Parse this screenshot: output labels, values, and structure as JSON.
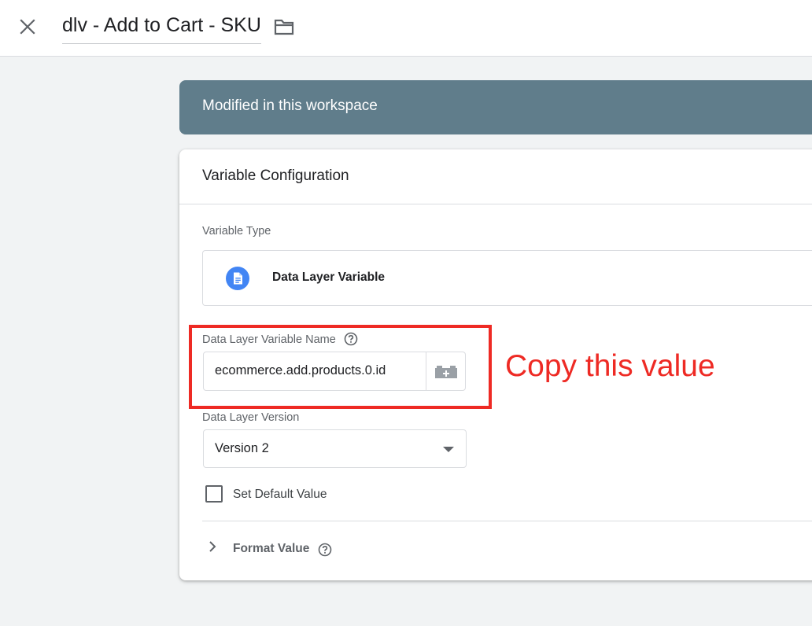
{
  "header": {
    "close_icon": "close-icon",
    "title": "dlv - Add to Cart - SKU",
    "folder_icon": "folder-icon"
  },
  "banner": {
    "text": "Modified in this workspace",
    "color": "#607d8b"
  },
  "card": {
    "title": "Variable Configuration",
    "variable_type": {
      "label": "Variable Type",
      "icon": "document-icon",
      "icon_color": "#4285f4",
      "value": "Data Layer Variable"
    },
    "variable_name": {
      "label": "Data Layer Variable Name",
      "help_icon": "help-icon",
      "value": "ecommerce.add.products.0.id",
      "picker_icon": "variable-picker-icon"
    },
    "version": {
      "label": "Data Layer Version",
      "selected": "Version 2"
    },
    "default_value": {
      "label": "Set Default Value",
      "checked": false
    },
    "format_value": {
      "label": "Format Value",
      "expanded": false,
      "help_icon": "help-icon"
    }
  },
  "annotation": {
    "text": "Copy this value",
    "color": "#ee2a24"
  }
}
